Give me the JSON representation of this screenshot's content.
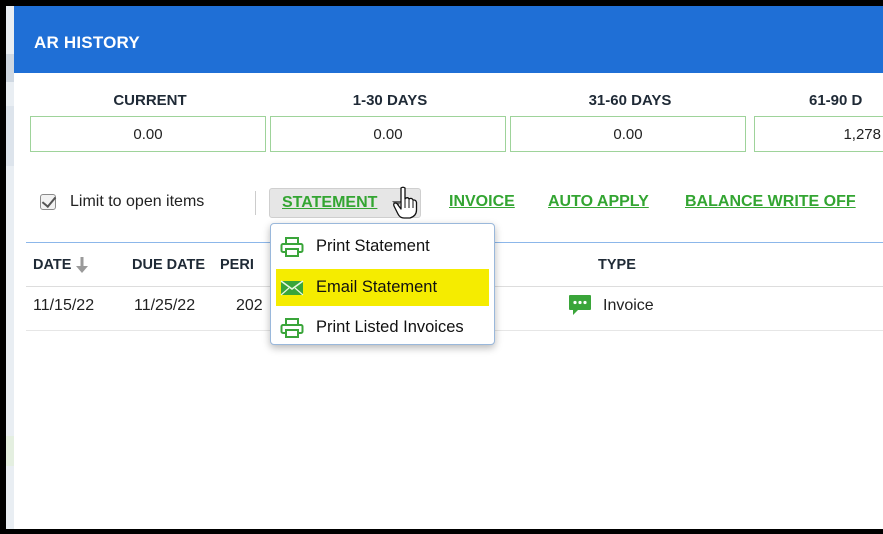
{
  "dialog": {
    "title": "AR HISTORY"
  },
  "aging": {
    "buckets": [
      {
        "label": "CURRENT",
        "value": "0.00"
      },
      {
        "label": "1-30 DAYS",
        "value": "0.00"
      },
      {
        "label": "31-60 DAYS",
        "value": "0.00"
      },
      {
        "label": "61-90 D",
        "value": "1,278"
      }
    ]
  },
  "toolbar": {
    "limit_open_items": {
      "label": "Limit to open items",
      "checked": true
    },
    "statement_label": "STATEMENT",
    "invoice_label": "INVOICE",
    "auto_apply_label": "AUTO APPLY",
    "balance_write_off_label": "BALANCE WRITE OFF"
  },
  "statement_menu": {
    "items": [
      {
        "label": "Print Statement",
        "icon": "printer-icon",
        "highlighted": false
      },
      {
        "label": "Email Statement",
        "icon": "envelope-icon",
        "highlighted": true
      },
      {
        "label": "Print Listed Invoices",
        "icon": "printer-icon",
        "highlighted": false
      }
    ]
  },
  "table": {
    "columns": [
      {
        "label": "DATE",
        "sort": "descending"
      },
      {
        "label": "DUE DATE"
      },
      {
        "label": "PERI"
      },
      {
        "label": "TYPE"
      }
    ],
    "rows": [
      {
        "date": "11/15/22",
        "due_date": "11/25/22",
        "period": "202",
        "type": "Invoice",
        "type_icon": "chat-bubble-icon"
      }
    ]
  },
  "colors": {
    "title_bar": "#1f6fd6",
    "link_green": "#33a532",
    "highlight_yellow": "#f5ec00",
    "aging_box_border": "#9ed39a"
  }
}
